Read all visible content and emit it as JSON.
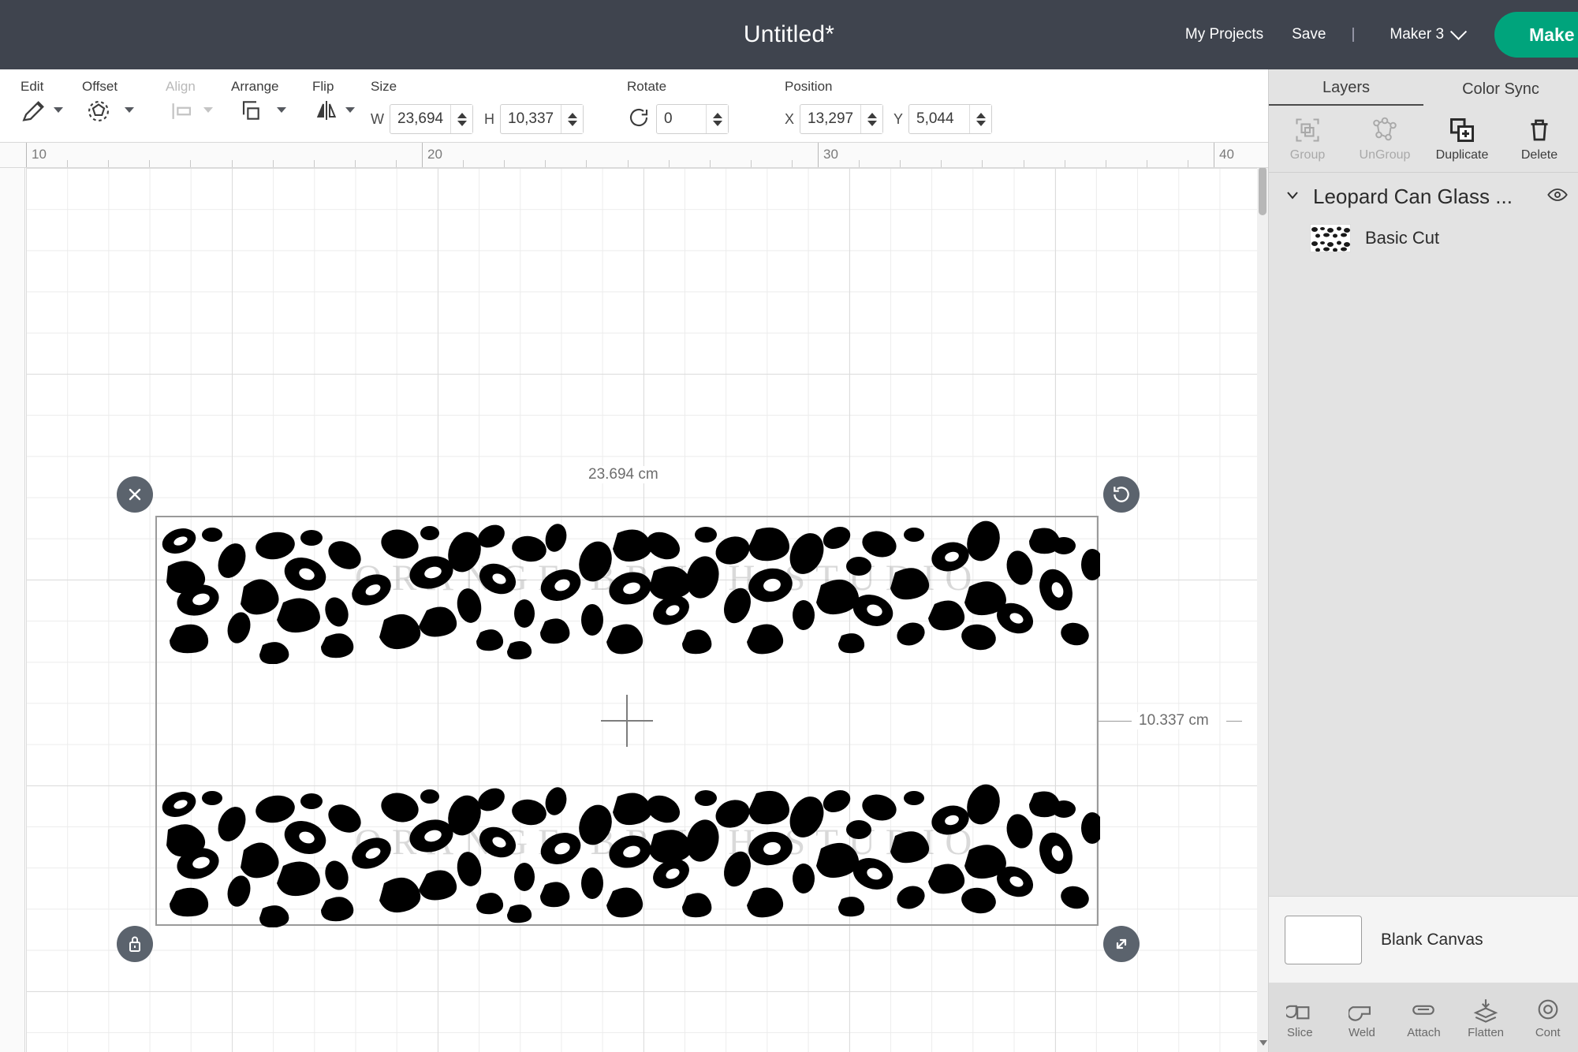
{
  "app": {
    "title": "Untitled*",
    "accent_green": "#00a47c",
    "topbar_bg": "#3f444e"
  },
  "topbar": {
    "my_projects": "My Projects",
    "save": "Save",
    "separator": "|",
    "machine": "Maker 3",
    "make_it": "Make It"
  },
  "toolbar": {
    "groups": [
      {
        "label": "Edit",
        "icon": "pencil-icon",
        "disabled": false,
        "has_caret": true
      },
      {
        "label": "Offset",
        "icon": "offset-icon",
        "disabled": false,
        "has_caret": true
      },
      {
        "label": "Align",
        "icon": "align-left-icon",
        "disabled": true,
        "has_caret": true
      },
      {
        "label": "Arrange",
        "icon": "arrange-icon",
        "disabled": false,
        "has_caret": true
      },
      {
        "label": "Flip",
        "icon": "flip-icon",
        "disabled": false,
        "has_caret": true
      }
    ],
    "size": {
      "label": "Size",
      "w_label": "W",
      "w_value": "23,694",
      "h_label": "H",
      "h_value": "10,337",
      "lock_icon": "unlock-icon"
    },
    "rotate": {
      "label": "Rotate",
      "icon": "rotate-icon",
      "value": "0"
    },
    "position": {
      "label": "Position",
      "x_label": "X",
      "x_value": "13,297",
      "y_label": "Y",
      "y_value": "5,044"
    }
  },
  "canvas": {
    "ruler_labels": [
      "10",
      "20",
      "30",
      "40"
    ],
    "unit": "cm",
    "width_label": "23.694 cm",
    "height_label": "10.337 cm",
    "watermark": "ORANGE BRUSH STUDIO",
    "handles": {
      "delete": "close-icon",
      "rotate": "rotate-icon",
      "lock": "lock-icon",
      "resize": "resize-icon"
    }
  },
  "right_panel": {
    "tabs": [
      {
        "label": "Layers",
        "active": true
      },
      {
        "label": "Color Sync",
        "active": false
      }
    ],
    "actions": [
      {
        "label": "Group",
        "icon": "group-icon",
        "disabled": true
      },
      {
        "label": "UnGroup",
        "icon": "ungroup-icon",
        "disabled": true
      },
      {
        "label": "Duplicate",
        "icon": "duplicate-icon",
        "disabled": false
      },
      {
        "label": "Delete",
        "icon": "delete-icon",
        "disabled": false
      }
    ],
    "layers": {
      "group_name": "Leopard Can Glass ...",
      "group_visibility_icon": "eye-icon",
      "group_chevron_icon": "chevron-down-icon",
      "children": [
        {
          "name": "Basic Cut",
          "thumbnail": "leopard-pattern-thumb"
        }
      ]
    },
    "canvas_item": {
      "name": "Blank Canvas",
      "swatch_color": "#ffffff"
    },
    "bottom_tools": [
      {
        "label": "Slice",
        "icon": "slice-icon"
      },
      {
        "label": "Weld",
        "icon": "weld-icon"
      },
      {
        "label": "Attach",
        "icon": "attach-icon"
      },
      {
        "label": "Flatten",
        "icon": "flatten-icon"
      },
      {
        "label": "Cont",
        "icon": "contour-icon"
      }
    ]
  }
}
